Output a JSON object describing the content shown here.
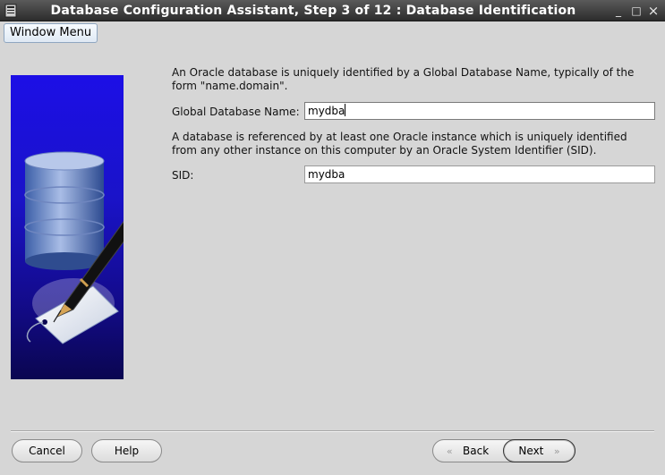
{
  "window": {
    "title": "Database Configuration Assistant, Step 3 of 12 : Database Identification",
    "controls": {
      "minimize": "_",
      "maximize": "□",
      "close": "×"
    }
  },
  "window_menu": {
    "label": "Window Menu"
  },
  "content": {
    "gdb_description": "An Oracle database is uniquely identified by a Global Database Name, typically of the form \"name.domain\".",
    "gdb_label": "Global Database Name:",
    "gdb_value": "mydba",
    "sid_description": "A database is referenced by at least one Oracle instance which is uniquely identified from any other instance on this computer by an Oracle System Identifier (SID).",
    "sid_label": "SID:",
    "sid_value": "mydba"
  },
  "buttons": {
    "cancel": "Cancel",
    "help": "Help",
    "back": "Back",
    "next": "Next"
  },
  "icons": {
    "app": "terminal-app-icon",
    "banner": "database-pen-illustration",
    "back_arrow": "«",
    "next_arrow": "»"
  },
  "colors": {
    "titlebar": "#3a3a3a",
    "background": "#d6d6d6",
    "banner_top": "#1c0fe6",
    "banner_bottom": "#0a0650"
  }
}
